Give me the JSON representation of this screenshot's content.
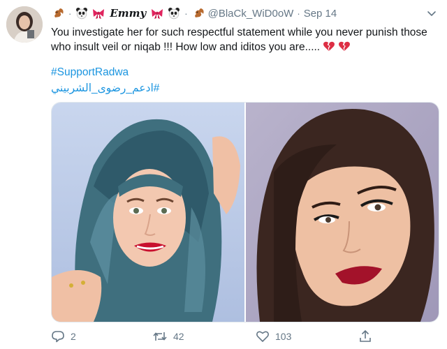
{
  "tweet": {
    "display_name": "Emmy",
    "handle": "@BlaCk_WiD0oW",
    "separator": "·",
    "date": "Sep 14",
    "name_emojis": [
      "squirrel",
      "panda",
      "bow"
    ],
    "text": "You investigate her for such respectful statement while you never punish those who insult veil or niqab !!! How low and iditos you are.....",
    "text_emojis": [
      "broken-heart",
      "broken-heart"
    ],
    "hashtags": [
      "#SupportRadwa",
      "#ادعم_رضوى_الشربيني"
    ],
    "media": [
      {
        "name": "woman-in-hijab-photo"
      },
      {
        "name": "woman-smiling-photo"
      }
    ],
    "actions": {
      "reply_count": "2",
      "retweet_count": "42",
      "like_count": "103"
    }
  },
  "colors": {
    "link": "#1b95e0",
    "secondary_text": "#657786",
    "primary_text": "#14171a"
  }
}
